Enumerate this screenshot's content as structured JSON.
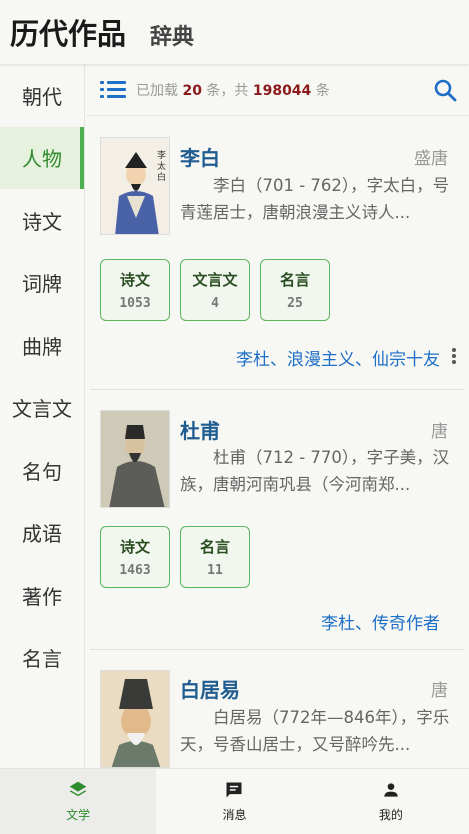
{
  "header": {
    "title": "历代作品",
    "subtitle": "辞典"
  },
  "sidebar": {
    "items": [
      {
        "label": "朝代",
        "active": false
      },
      {
        "label": "人物",
        "active": true
      },
      {
        "label": "诗文",
        "active": false
      },
      {
        "label": "词牌",
        "active": false
      },
      {
        "label": "曲牌",
        "active": false
      },
      {
        "label": "文言文",
        "active": false
      },
      {
        "label": "名句",
        "active": false
      },
      {
        "label": "成语",
        "active": false
      },
      {
        "label": "著作",
        "active": false
      },
      {
        "label": "名言",
        "active": false
      }
    ]
  },
  "toolbar": {
    "loaded_prefix": "已加载",
    "loaded_count": "20",
    "loaded_mid": "条，共",
    "total_count": "198044",
    "loaded_suffix": "条"
  },
  "cards": [
    {
      "name": "李白",
      "dynasty": "盛唐",
      "desc": "李白（701 - 762），字太白，号青莲居士，唐朝浪漫主义诗人...",
      "stats": [
        {
          "label": "诗文",
          "value": "1053"
        },
        {
          "label": "文言文",
          "value": "4"
        },
        {
          "label": "名言",
          "value": "25"
        }
      ],
      "tags": "李杜、浪漫主义、仙宗十友"
    },
    {
      "name": "杜甫",
      "dynasty": "唐",
      "desc": "杜甫（712 - 770），字子美，汉族，唐朝河南巩县（今河南郑...",
      "stats": [
        {
          "label": "诗文",
          "value": "1463"
        },
        {
          "label": "名言",
          "value": "11"
        }
      ],
      "tags": "李杜、传奇作者"
    },
    {
      "name": "白居易",
      "dynasty": "唐",
      "desc": "白居易（772年—846年），字乐天，号香山居士，又号醉吟先...",
      "stats": [],
      "tags": ""
    }
  ],
  "bottom_nav": [
    {
      "label": "文学",
      "icon": "layers-icon",
      "active": true
    },
    {
      "label": "消息",
      "icon": "message-icon",
      "active": false
    },
    {
      "label": "我的",
      "icon": "person-icon",
      "active": false
    }
  ],
  "colors": {
    "accent_green": "#4caf50",
    "link_blue": "#1e6fc7",
    "count_red": "#8b1a1a",
    "name_blue": "#1f5c8f"
  }
}
